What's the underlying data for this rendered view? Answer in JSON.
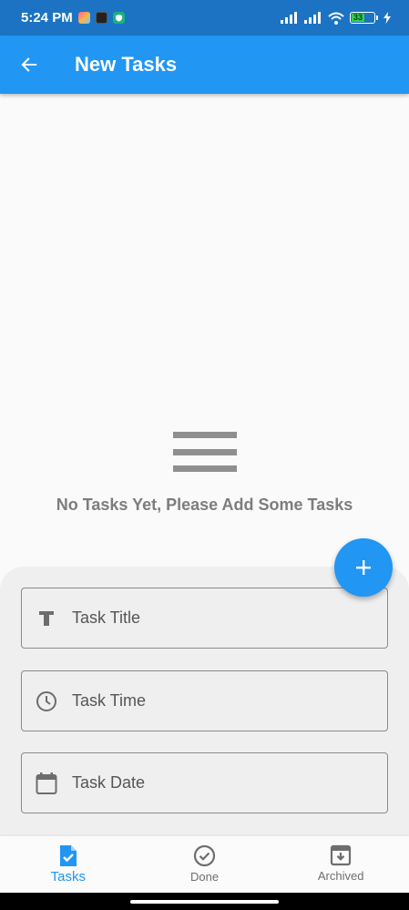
{
  "status_bar": {
    "time": "5:24 PM",
    "battery_level": "33",
    "icons": [
      "photos-app-icon",
      "news-app-icon",
      "security-app-icon",
      "signal-icon",
      "signal-icon",
      "wifi-icon",
      "battery-icon",
      "charging-icon"
    ]
  },
  "app_bar": {
    "title": "New Tasks",
    "background": "#2196f3"
  },
  "empty_state": {
    "icon": "menu-icon",
    "message": "No Tasks Yet, Please Add Some Tasks"
  },
  "form": {
    "fields": [
      {
        "icon": "text-title-icon",
        "label": "Task Title"
      },
      {
        "icon": "clock-icon",
        "label": "Task Time"
      },
      {
        "icon": "calendar-icon",
        "label": "Task Date"
      }
    ]
  },
  "fab": {
    "icon": "plus-icon"
  },
  "bottom_nav": {
    "items": [
      {
        "label": "Tasks",
        "icon": "task-document-icon",
        "active": true
      },
      {
        "label": "Done",
        "icon": "check-circle-icon",
        "active": false
      },
      {
        "label": "Archived",
        "icon": "archive-icon",
        "active": false
      }
    ]
  },
  "colors": {
    "primary": "#2196f3",
    "status_bar": "#1c73c3",
    "muted_text": "#7d7d7d"
  }
}
